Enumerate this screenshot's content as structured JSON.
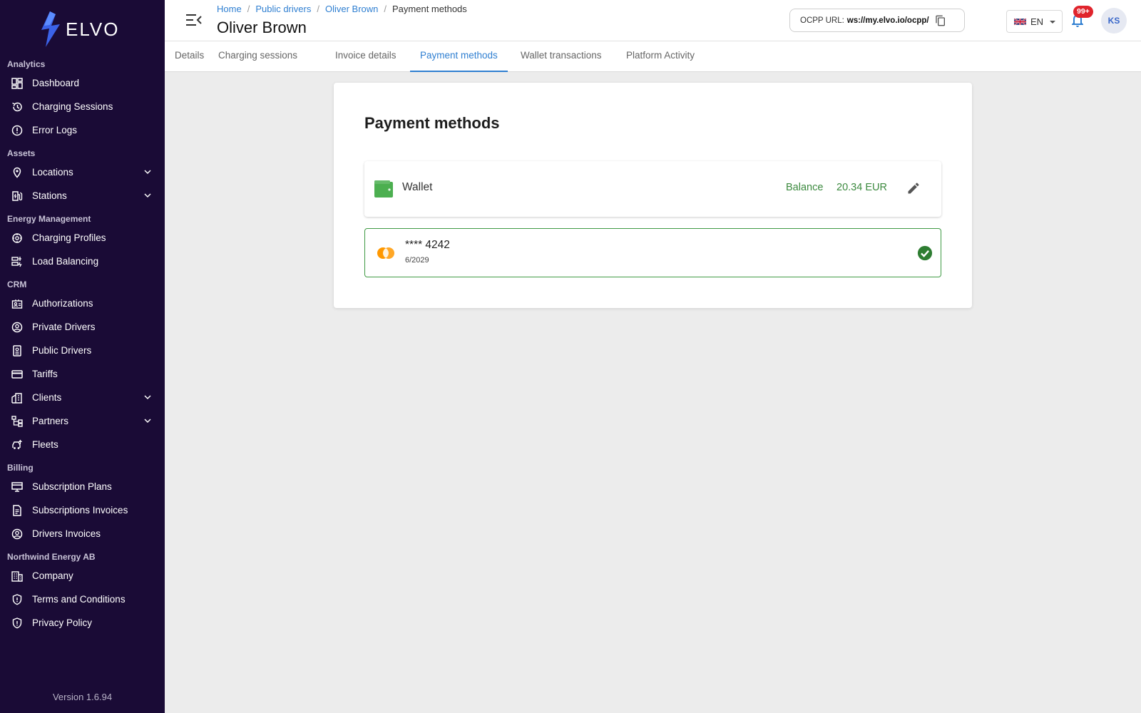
{
  "brand": {
    "name": "ELVO",
    "accent": "#2f7fd1",
    "sidebar_bg": "#1a0b36",
    "success": "#3f9a44"
  },
  "sidebar": {
    "sections": [
      {
        "label": "Analytics",
        "items": [
          {
            "label": "Dashboard",
            "icon": "dashboard-icon"
          },
          {
            "label": "Charging Sessions",
            "icon": "history-icon"
          },
          {
            "label": "Error Logs",
            "icon": "error-icon"
          }
        ]
      },
      {
        "label": "Assets",
        "items": [
          {
            "label": "Locations",
            "icon": "location-pin-icon",
            "expandable": true
          },
          {
            "label": "Stations",
            "icon": "ev-station-icon",
            "expandable": true
          }
        ]
      },
      {
        "label": "Energy Management",
        "items": [
          {
            "label": "Charging Profiles",
            "icon": "profiles-icon"
          },
          {
            "label": "Load Balancing",
            "icon": "load-balancing-icon"
          }
        ]
      },
      {
        "label": "CRM",
        "items": [
          {
            "label": "Authorizations",
            "icon": "authorizations-icon"
          },
          {
            "label": "Private Drivers",
            "icon": "user-circle-icon"
          },
          {
            "label": "Public Drivers",
            "icon": "badge-icon"
          },
          {
            "label": "Tariffs",
            "icon": "credit-card-icon"
          },
          {
            "label": "Clients",
            "icon": "building-icon",
            "expandable": true
          },
          {
            "label": "Partners",
            "icon": "hierarchy-icon",
            "expandable": true
          },
          {
            "label": "Fleets",
            "icon": "car-icon"
          }
        ]
      },
      {
        "label": "Billing",
        "items": [
          {
            "label": "Subscription Plans",
            "icon": "monitor-icon"
          },
          {
            "label": "Subscriptions Invoices",
            "icon": "document-icon"
          },
          {
            "label": "Drivers Invoices",
            "icon": "user-circle-icon"
          }
        ]
      },
      {
        "label": "Northwind Energy AB",
        "items": [
          {
            "label": "Company",
            "icon": "company-icon"
          },
          {
            "label": "Terms and Conditions",
            "icon": "shield-icon"
          },
          {
            "label": "Privacy Policy",
            "icon": "shield-icon"
          }
        ]
      }
    ],
    "version": "Version 1.6.94"
  },
  "header": {
    "breadcrumb": [
      "Home",
      "Public drivers",
      "Oliver Brown",
      "Payment methods"
    ],
    "title": "Oliver Brown",
    "ocpp_label": "OCPP URL:",
    "ocpp_url": "ws://my.elvo.io/ocpp/",
    "language": "EN",
    "notification_count": "99+",
    "avatar_initials": "KS"
  },
  "tabs": [
    {
      "label": "Details",
      "active": false
    },
    {
      "label": "Charging sessions",
      "active": false
    },
    {
      "label": "Invoice details",
      "active": false
    },
    {
      "label": "Payment methods",
      "active": true
    },
    {
      "label": "Wallet transactions",
      "active": false
    },
    {
      "label": "Platform Activity",
      "active": false
    }
  ],
  "main": {
    "title": "Payment methods",
    "wallet": {
      "label": "Wallet",
      "balance_label": "Balance",
      "balance_value": "20.34 EUR"
    },
    "card": {
      "number": "**** 4242",
      "expiry": "6/2029",
      "default": true
    }
  }
}
